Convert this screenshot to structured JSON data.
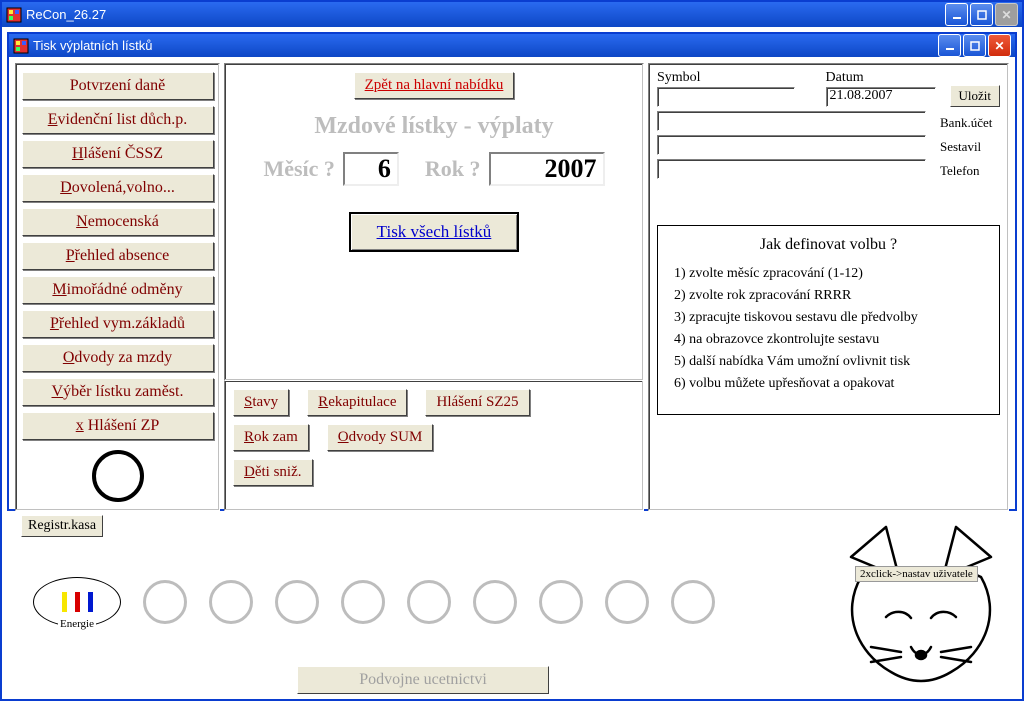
{
  "outer": {
    "title": "ReCon_26.27"
  },
  "inner": {
    "title": "Tisk výplatních lístků"
  },
  "left_buttons": [
    "Potvrzení daně",
    "Evidenční list důch.p.",
    "Hlášení ČSSZ",
    "Dovolená,volno...",
    "Nemocenská",
    "Přehled absence",
    "Mimořádné odměny",
    "Přehled vym.základů",
    "Odvody za mzdy",
    "Výběr lístku zaměst.",
    "x Hlášení ZP"
  ],
  "center": {
    "back_btn": "Zpět na hlavní nabídku",
    "heading": "Mzdové lístky - výplaty",
    "month_label": "Měsíc ?",
    "month_value": "6",
    "year_label": "Rok ?",
    "year_value": "2007",
    "print_all": "Tisk všech lístků"
  },
  "mid_lower": {
    "row1": [
      "Stavy",
      "Rekapitulace",
      "Hlášení SZ25"
    ],
    "row2": [
      "Rok zam",
      "Odvody SUM"
    ],
    "row3": [
      "Děti sniž."
    ]
  },
  "right_form": {
    "symbol_label": "Symbol",
    "symbol_value": "",
    "date_label": "Datum",
    "date_value": "21.08.2007",
    "save": "Uložit",
    "bank": "Bank.účet",
    "sestavil": "Sestavil",
    "telefon": "Telefon"
  },
  "help": {
    "title": "Jak definovat volbu ?",
    "lines": [
      "1) zvolte měsíc zpracování (1-12)",
      "2) zvolte rok zpracování RRRR",
      "3) zpracujte tiskovou sestavu dle předvolby",
      "4) na obrazovce zkontrolujte sestavu",
      "5) další nabídka Vám umožní ovlivnit tisk",
      "6) volbu můžete upřesňovat a opakovat"
    ]
  },
  "bottom": {
    "registr": "Registr.kasa",
    "energie": "Energie",
    "fox_tip": "2xclick->nastav uživatele",
    "podvojne": "Podvojne ucetnictvi"
  }
}
